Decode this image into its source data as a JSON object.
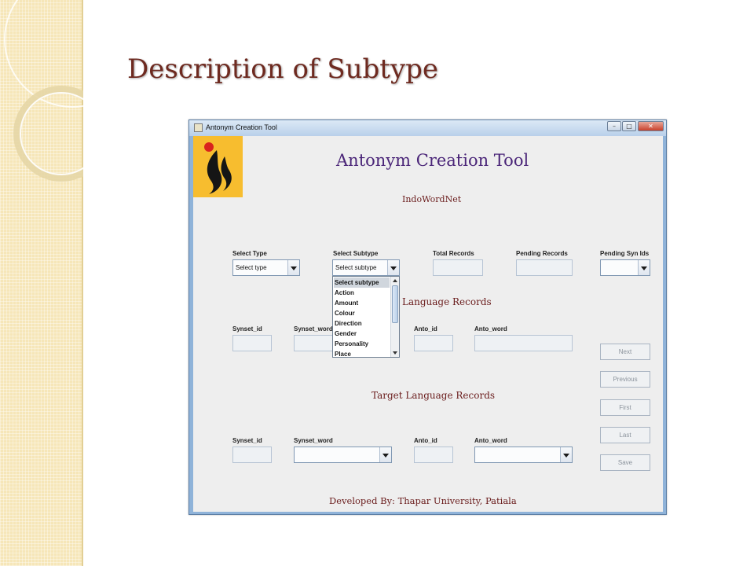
{
  "slide": {
    "title": "Description of Subtype",
    "accent_color": "#6e2a20",
    "decoration_color": "#f6e6b8"
  },
  "window": {
    "title": "Antonym Creation Tool",
    "icon": "app-icon",
    "controls": [
      "minimize-icon",
      "maximize-icon",
      "close-icon"
    ]
  },
  "app": {
    "heading": "Antonym Creation Tool",
    "subheading": "IndoWordNet",
    "logo_icon": "flame-logo-icon",
    "logo_color": "#f7bd2f",
    "top_fields": {
      "select_type_label": "Select Type",
      "select_type_value": "Select type",
      "select_subtype_label": "Select Subtype",
      "select_subtype_value": "Select subtype",
      "total_records_label": "Total Records",
      "total_records_value": "",
      "pending_records_label": "Pending Records",
      "pending_records_value": "",
      "pending_syn_ids_label": "Pending Syn Ids",
      "pending_syn_ids_value": ""
    },
    "subtype_dropdown": {
      "options": [
        "Select subtype",
        "Action",
        "Amount",
        "Colour",
        "Direction",
        "Gender",
        "Personality",
        "Place"
      ],
      "selected": "Select subtype"
    },
    "source_section": {
      "title": "Language  Records",
      "synset_id_label": "Synset_id",
      "synset_word_label": "Synset_word",
      "anto_id_label": "Anto_id",
      "anto_word_label": "Anto_word"
    },
    "target_section": {
      "title": "Target  Language  Records",
      "synset_id_label": "Synset_id",
      "synset_word_label": "Synset_word",
      "anto_id_label": "Anto_id",
      "anto_word_label": "Anto_word",
      "synset_word_value": "",
      "anto_word_value": ""
    },
    "buttons": {
      "next": "Next",
      "previous": "Previous",
      "first": "First",
      "last": "Last",
      "save": "Save"
    },
    "footer": "Developed By: Thapar University, Patiala"
  }
}
